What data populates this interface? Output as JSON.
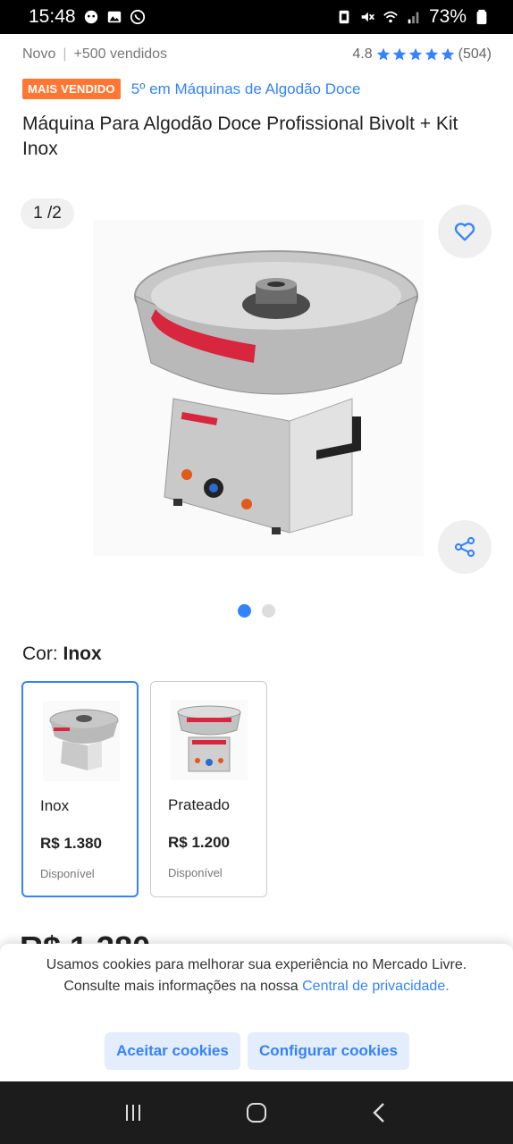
{
  "status_bar": {
    "time": "15:48",
    "battery": "73%",
    "icons": [
      "face-icon",
      "gallery-icon",
      "whatsapp-icon",
      "nfc-icon",
      "mute-icon",
      "wifi-icon",
      "signal-icon",
      "battery-icon"
    ]
  },
  "product": {
    "condition": "Novo",
    "sold": "+500 vendidos",
    "rating": "4.8",
    "reviews": "(504)",
    "badge": "MAIS VENDIDO",
    "ranking": "5º em Máquinas de Algodão Doce",
    "title": "Máquina Para Algodão Doce Profissional Bivolt + Kit Inox"
  },
  "gallery": {
    "counter": "1 /2",
    "current_index": 1,
    "total": 2
  },
  "variants": {
    "label": "Cor: ",
    "selected": "Inox",
    "options": [
      {
        "name": "Inox",
        "price": "R$ 1.380",
        "availability": "Disponível"
      },
      {
        "name": "Prateado",
        "price": "R$ 1.200",
        "availability": "Disponível"
      }
    ]
  },
  "price_peek": "R$ 1.380",
  "cookie_banner": {
    "text": "Usamos cookies para melhorar sua experiência no Mercado Livre. Consulte mais informações na nossa ",
    "link": "Central de privacidade.",
    "accept": "Aceitar cookies",
    "configure": "Configurar cookies"
  },
  "colors": {
    "accent": "#3483fa",
    "badge": "#ff7733",
    "star": "#3483fa"
  }
}
